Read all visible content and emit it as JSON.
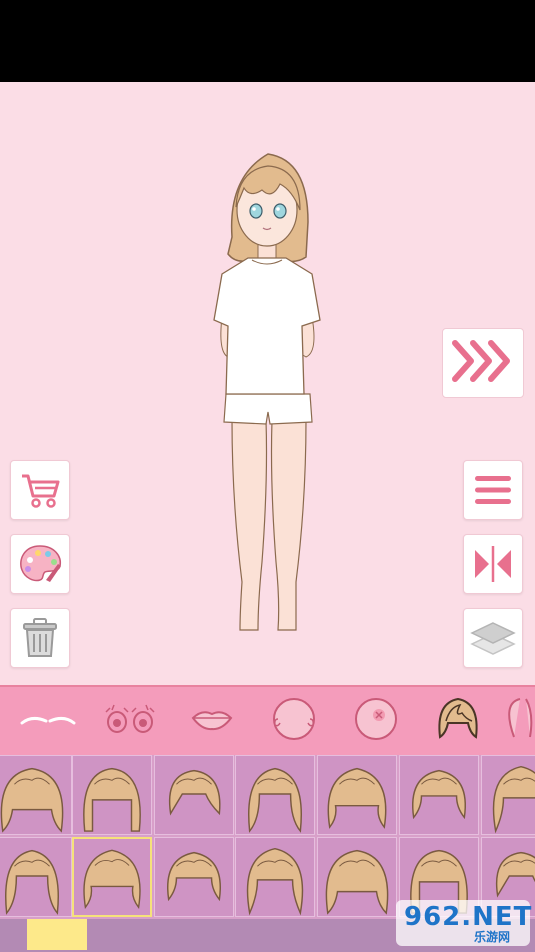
{
  "app": {
    "background": "#fbdde6",
    "accent": "#f49cbb",
    "icon_color": "#e8708e"
  },
  "left_tools": [
    {
      "name": "cart-icon"
    },
    {
      "name": "palette-icon"
    },
    {
      "name": "trash-icon"
    }
  ],
  "right_tools": [
    {
      "name": "menu-icon"
    },
    {
      "name": "flip-icon"
    },
    {
      "name": "layers-icon"
    }
  ],
  "next_button": {
    "icon": "chevron-triple-right-icon"
  },
  "categories": [
    {
      "name": "eyebrows-icon",
      "selected": false
    },
    {
      "name": "eyes-icon",
      "selected": false
    },
    {
      "name": "mouth-icon",
      "selected": false
    },
    {
      "name": "face-icon",
      "selected": false
    },
    {
      "name": "face-blush-icon",
      "selected": false
    },
    {
      "name": "hair-front-icon",
      "selected": true
    },
    {
      "name": "hair-back-icon",
      "selected": false
    }
  ],
  "hair_grid": {
    "rows": 2,
    "columns": 7,
    "selected_index": 8,
    "hair_color": "#e2bb8e"
  },
  "selected_color": "#fde98a",
  "watermark": {
    "big": "962.NET",
    "small": "乐游网"
  }
}
